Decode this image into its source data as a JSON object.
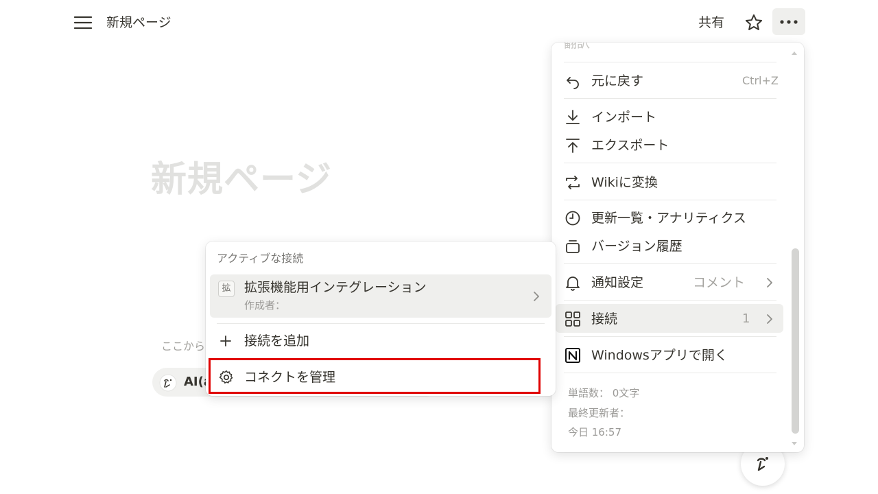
{
  "topbar": {
    "page_name": "新規ページ",
    "share_label": "共有",
    "icons": [
      "menu-icon",
      "star-icon",
      "more-dots-icon"
    ]
  },
  "page": {
    "title_placeholder": "新規ページ",
    "hint": "ここから",
    "ai_chip_label": "AI(a"
  },
  "more_menu": {
    "partial_top_label": "翻訳",
    "undo": {
      "label": "元に戻す",
      "shortcut": "Ctrl+Z"
    },
    "import": {
      "label": "インポート"
    },
    "export": {
      "label": "エクスポート"
    },
    "wiki": {
      "label": "Wikiに変換"
    },
    "updates": {
      "label": "更新一覧・アナリティクス"
    },
    "versions": {
      "label": "バージョン履歴"
    },
    "notifications": {
      "label": "通知設定",
      "value": "コメント"
    },
    "connections": {
      "label": "接続",
      "count": "1"
    },
    "open_app": {
      "label": "Windowsアプリで開く"
    },
    "word_count": "単語数： 0文字",
    "last_edited_by": "最終更新者：",
    "last_edited_at": "今日 16:57"
  },
  "connections_popup": {
    "header": "アクティブな接続",
    "item": {
      "badge": "拡",
      "title": "拡張機能用インテグレーション",
      "subtitle": "作成者："
    },
    "add_label": "接続を追加",
    "manage_label": "コネクトを管理"
  },
  "colors": {
    "highlight_border": "#e00000",
    "text": "#37352f",
    "muted": "#9b9a97"
  }
}
